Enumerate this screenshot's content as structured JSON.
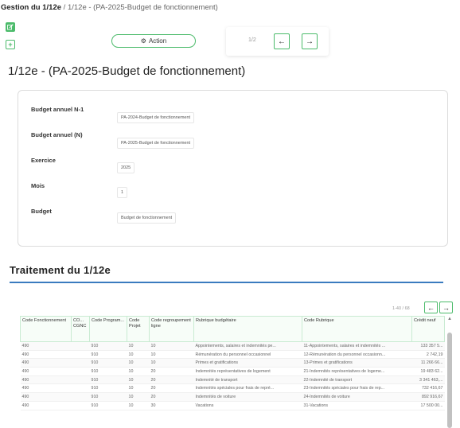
{
  "breadcrumb": {
    "root": "Gestion du 1/12e",
    "separator": " / ",
    "current": "1/12e - (PA-2025-Budget de fonctionnement)"
  },
  "toolbar": {
    "edit_icon": "edit-icon",
    "add_icon": "plus-icon",
    "add_symbol": "+",
    "action_label": "Action",
    "action_icon": "gear-icon"
  },
  "pager": {
    "count": "1/2",
    "prev_symbol": "←",
    "next_symbol": "→"
  },
  "page_title": "1/12e - (PA-2025-Budget de fonctionnement)",
  "form": {
    "fields": [
      {
        "label": "Budget annuel N-1",
        "value": "PA-2024-Budget de fonctionnement"
      },
      {
        "label": "Budget annuel (N)",
        "value": "PA-2025-Budget de fonctionnement"
      },
      {
        "label": "Exercice",
        "value": "2025"
      },
      {
        "label": "Mois",
        "value": "1"
      },
      {
        "label": "Budget",
        "value": "Budget de fonctionnement"
      }
    ]
  },
  "section": {
    "title": "Traitement du 1/12e"
  },
  "table": {
    "count": "1-40 / 68",
    "prev_symbol": "←",
    "next_symbol": "→",
    "columns": [
      "Code Fonctionnement",
      "CO... CGNC",
      "Code Program...",
      "Code Projet",
      "Code regroupement ligne",
      "Rubrique budgétaire",
      "Code Rubrique",
      "Crédit neuf"
    ],
    "rows": [
      [
        "490",
        "",
        "910",
        "10",
        "10",
        "Appointements, salaires et indemnités pe...",
        "11-Appointements, salaires et indemnités ...",
        "133 357 5..."
      ],
      [
        "490",
        "",
        "910",
        "10",
        "10",
        "Rémunération du personnel occasionnel",
        "12-Rémunération du personnel occasionn...",
        "2 742,19"
      ],
      [
        "490",
        "",
        "910",
        "10",
        "10",
        "Primes et gratifications",
        "13-Primes et gratifications",
        "11 266 66..."
      ],
      [
        "490",
        "",
        "910",
        "10",
        "20",
        "Indemnités représentatives de logement",
        "21-Indemnités représentatives de logeme...",
        "19 483 62..."
      ],
      [
        "490",
        "",
        "910",
        "10",
        "20",
        "Indemnité de transport",
        "22-Indemnité de transport",
        "3 341 463,..."
      ],
      [
        "490",
        "",
        "910",
        "10",
        "20",
        "Indemnités spéciales pour frais de repré...",
        "23-Indemnités spéciales pour frais de rep...",
        "732 416,67"
      ],
      [
        "490",
        "",
        "910",
        "10",
        "20",
        "Indemnités de voiture",
        "24-Indemnités de voiture",
        "892 916,67"
      ],
      [
        "490",
        "",
        "910",
        "10",
        "30",
        "Vacations",
        "31-Vacations",
        "17 500 00..."
      ]
    ]
  },
  "colors": {
    "accent": "#4cbb6b",
    "section_rule": "#3a7bbf",
    "header_bg": "#f7fdf8"
  }
}
